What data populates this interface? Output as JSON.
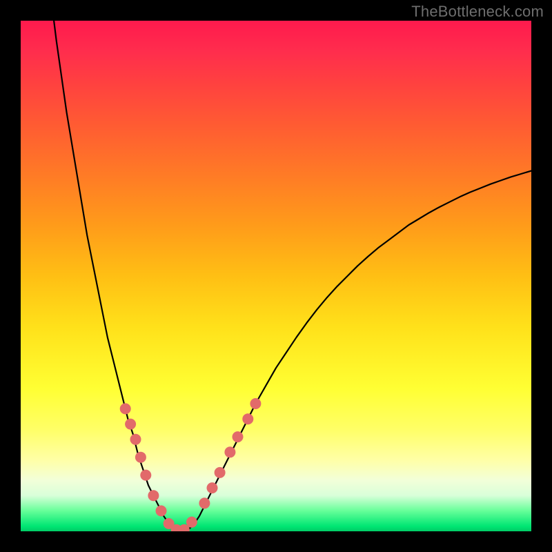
{
  "attribution": "TheBottleneck.com",
  "chart_data": {
    "type": "line",
    "title": "",
    "xlabel": "",
    "ylabel": "",
    "xlim": [
      0,
      100
    ],
    "ylim": [
      0,
      100
    ],
    "gradient_stops": [
      {
        "pct": 0,
        "color": "#ff1a4d"
      },
      {
        "pct": 6,
        "color": "#ff2d4d"
      },
      {
        "pct": 12,
        "color": "#ff4040"
      },
      {
        "pct": 20,
        "color": "#ff5a33"
      },
      {
        "pct": 30,
        "color": "#ff7a26"
      },
      {
        "pct": 40,
        "color": "#ff9b1a"
      },
      {
        "pct": 50,
        "color": "#ffbf14"
      },
      {
        "pct": 60,
        "color": "#ffe11a"
      },
      {
        "pct": 72,
        "color": "#ffff33"
      },
      {
        "pct": 80,
        "color": "#ffff66"
      },
      {
        "pct": 86,
        "color": "#ffffa6"
      },
      {
        "pct": 90,
        "color": "#f2ffd9"
      },
      {
        "pct": 93,
        "color": "#d9ffd9"
      },
      {
        "pct": 96,
        "color": "#66ff99"
      },
      {
        "pct": 99,
        "color": "#00e673"
      },
      {
        "pct": 100,
        "color": "#00cc66"
      }
    ],
    "series": [
      {
        "name": "bottleneck-curve",
        "color": "#000000",
        "x": [
          6.5,
          7,
          8,
          9,
          10,
          11,
          12,
          13,
          14,
          15,
          16,
          17,
          18,
          19,
          20,
          21,
          22,
          23,
          24,
          25,
          26,
          27,
          28,
          29,
          30,
          31,
          32,
          33,
          34,
          35,
          36,
          38,
          40,
          42,
          44,
          46,
          48,
          50,
          52,
          54,
          56,
          58,
          60,
          62,
          64,
          66,
          68,
          70,
          72,
          74,
          76,
          78,
          80,
          82,
          84,
          86,
          88,
          90,
          92,
          94,
          96,
          98,
          100
        ],
        "y": [
          100,
          96,
          89,
          82,
          76,
          70,
          64,
          58,
          53,
          48,
          43,
          38,
          34,
          30,
          26,
          22,
          19,
          15,
          12,
          9,
          7,
          5,
          3,
          1.5,
          0.5,
          0,
          0,
          0.5,
          1.5,
          3,
          5,
          9,
          13,
          17,
          21,
          25,
          28.5,
          32,
          35,
          38,
          40.8,
          43.4,
          45.8,
          48,
          50,
          52,
          53.8,
          55.5,
          57,
          58.5,
          60,
          61.2,
          62.4,
          63.5,
          64.5,
          65.5,
          66.4,
          67.2,
          68,
          68.7,
          69.4,
          70,
          70.6
        ]
      }
    ],
    "markers": {
      "name": "highlight-dots",
      "color": "#e26a6a",
      "radius": 8,
      "points": [
        {
          "x": 20.5,
          "y": 24
        },
        {
          "x": 21.5,
          "y": 21
        },
        {
          "x": 22.5,
          "y": 18
        },
        {
          "x": 23.5,
          "y": 14.5
        },
        {
          "x": 24.5,
          "y": 11
        },
        {
          "x": 26,
          "y": 7
        },
        {
          "x": 27.5,
          "y": 4
        },
        {
          "x": 29,
          "y": 1.5
        },
        {
          "x": 30.5,
          "y": 0.3
        },
        {
          "x": 32,
          "y": 0.3
        },
        {
          "x": 33.5,
          "y": 1.8
        },
        {
          "x": 36,
          "y": 5.5
        },
        {
          "x": 37.5,
          "y": 8.5
        },
        {
          "x": 39,
          "y": 11.5
        },
        {
          "x": 41,
          "y": 15.5
        },
        {
          "x": 42.5,
          "y": 18.5
        },
        {
          "x": 44.5,
          "y": 22
        },
        {
          "x": 46,
          "y": 25
        }
      ]
    }
  }
}
